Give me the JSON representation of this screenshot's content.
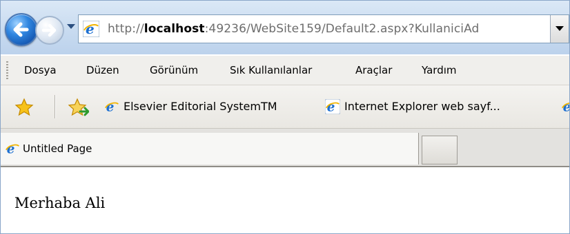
{
  "browser": {
    "url": {
      "scheme": "http://",
      "host": "localhost",
      "rest": ":49236/WebSite159/Default2.aspx?KullaniciAd"
    },
    "menu": [
      {
        "label": "Dosya"
      },
      {
        "label": "Düzen"
      },
      {
        "label": "Görünüm"
      },
      {
        "label": "Sık Kullanılanlar"
      },
      {
        "label": "Araçlar"
      },
      {
        "label": "Yardım"
      }
    ],
    "favorites": [
      {
        "label": "Elsevier Editorial SystemTM"
      },
      {
        "label": "Internet Explorer web sayf..."
      }
    ],
    "tab": {
      "title": "Untitled Page"
    },
    "icons": {
      "back": "back-arrow-icon",
      "forward": "forward-arrow-icon",
      "ie": "internet-explorer-icon",
      "favorites": "star-icon",
      "add_favorite": "add-favorite-icon"
    },
    "colors": {
      "chrome_blue": "#c8dbf0",
      "button_blue": "#2f86e0",
      "menu_bg": "#f0efec"
    }
  },
  "page": {
    "greeting": "Merhaba Ali"
  }
}
